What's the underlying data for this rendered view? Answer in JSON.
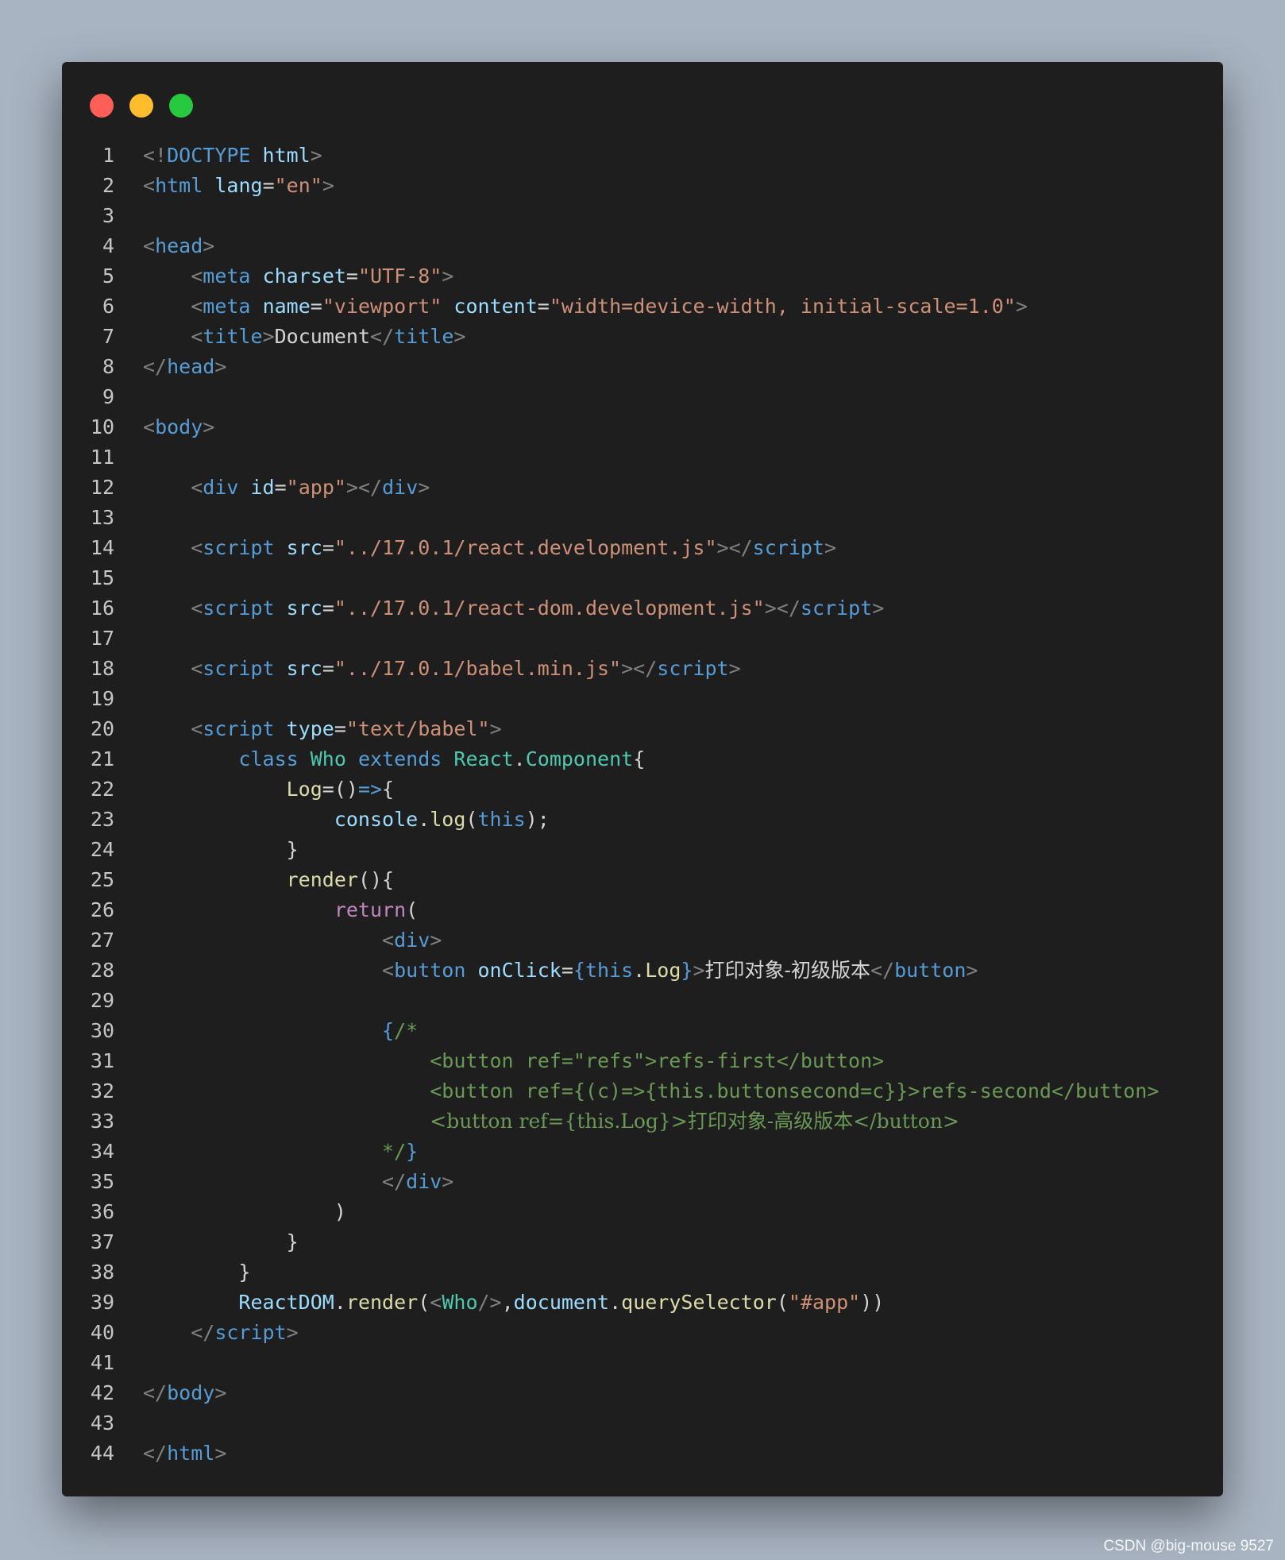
{
  "window": {
    "controls": [
      {
        "name": "close",
        "color": "#ff5f56"
      },
      {
        "name": "minimize",
        "color": "#ffbd2e"
      },
      {
        "name": "maximize",
        "color": "#27c93f"
      }
    ]
  },
  "editor": {
    "line_numbers": [
      "1",
      "2",
      "3",
      "4",
      "5",
      "6",
      "7",
      "8",
      "9",
      "10",
      "11",
      "12",
      "13",
      "14",
      "15",
      "16",
      "17",
      "18",
      "19",
      "20",
      "21",
      "22",
      "23",
      "24",
      "25",
      "26",
      "27",
      "28",
      "29",
      "30",
      "31",
      "32",
      "33",
      "34",
      "35",
      "36",
      "37",
      "38",
      "39",
      "40",
      "41",
      "42",
      "43",
      "44"
    ],
    "indent": [
      "",
      "    ",
      "        ",
      "            ",
      "                ",
      "                    "
    ],
    "lines": {
      "l1": [
        "<!",
        "DOCTYPE",
        " html",
        ">"
      ],
      "l2": [
        "<",
        "html",
        " ",
        "lang",
        "=",
        "\"en\"",
        ">"
      ],
      "l4": [
        "<",
        "head",
        ">"
      ],
      "l5": [
        "<",
        "meta",
        " ",
        "charset",
        "=",
        "\"UTF-8\"",
        ">"
      ],
      "l6": [
        "<",
        "meta",
        " ",
        "name",
        "=",
        "\"viewport\"",
        " ",
        "content",
        "=",
        "\"width=device-width, initial-scale=1.0\"",
        ">"
      ],
      "l7": [
        "<",
        "title",
        ">",
        "Document",
        "</",
        "title",
        ">"
      ],
      "l8": [
        "</",
        "head",
        ">"
      ],
      "l10": [
        "<",
        "body",
        ">"
      ],
      "l12": [
        "<",
        "div",
        " ",
        "id",
        "=",
        "\"app\"",
        "></",
        "div",
        ">"
      ],
      "l14": [
        "<",
        "script",
        " ",
        "src",
        "=",
        "\"../17.0.1/react.development.js\"",
        "></",
        "script",
        ">"
      ],
      "l16": [
        "<",
        "script",
        " ",
        "src",
        "=",
        "\"../17.0.1/react-dom.development.js\"",
        "></",
        "script",
        ">"
      ],
      "l18": [
        "<",
        "script",
        " ",
        "src",
        "=",
        "\"../17.0.1/babel.min.js\"",
        "></",
        "script",
        ">"
      ],
      "l20": [
        "<",
        "script",
        " ",
        "type",
        "=",
        "\"text/babel\"",
        ">"
      ],
      "l21": [
        "class",
        " ",
        "Who",
        " ",
        "extends",
        " ",
        "React",
        ".",
        "Component",
        "{"
      ],
      "l22": [
        "Log",
        "=()",
        "=>",
        "{"
      ],
      "l23": [
        "console",
        ".",
        "log",
        "(",
        "this",
        ");"
      ],
      "l24": [
        "}"
      ],
      "l25": [
        "render",
        "(){"
      ],
      "l26": [
        "return",
        "("
      ],
      "l27": [
        "<",
        "div",
        ">"
      ],
      "l28": [
        "<",
        "button",
        " ",
        "onClick",
        "=",
        "{",
        "this",
        ".",
        "Log",
        "}",
        ">",
        "打印对象-初级版本",
        "</",
        "button",
        ">"
      ],
      "l30": [
        "{",
        "/*"
      ],
      "l31": [
        "<button ref=\"refs\">refs-first</button>"
      ],
      "l32": [
        "<button ref={(c)=>{this.buttonsecond=c}}>refs-second</button>"
      ],
      "l33": [
        "<button ref={this.Log}>打印对象-高级版本</button>"
      ],
      "l34": [
        "*/",
        "}"
      ],
      "l35": [
        "</",
        "div",
        ">"
      ],
      "l36": [
        ")"
      ],
      "l37": [
        "}"
      ],
      "l38": [
        "}"
      ],
      "l39": [
        "ReactDOM",
        ".",
        "render",
        "(",
        "<",
        "Who",
        "/>",
        ",",
        "document",
        ".",
        "querySelector",
        "(",
        "\"#app\"",
        "))"
      ],
      "l40": [
        "</",
        "script",
        ">"
      ],
      "l42": [
        "</",
        "body",
        ">"
      ],
      "l44": [
        "</",
        "html",
        ">"
      ]
    }
  },
  "watermark": "CSDN @big-mouse 9527"
}
